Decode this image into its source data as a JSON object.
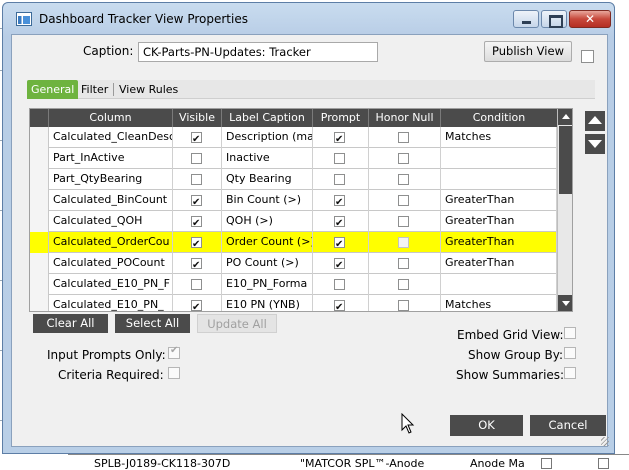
{
  "window": {
    "title": "Dashboard Tracker View Properties",
    "close_glyph": "✕"
  },
  "caption": {
    "label": "Caption:",
    "value": "CK-Parts-PN-Updates: Tracker"
  },
  "publish_button": "Publish View",
  "tabs": [
    {
      "label": "General",
      "active": true
    },
    {
      "label": "Filter",
      "active": false
    },
    {
      "label": "View Rules",
      "active": false
    }
  ],
  "grid": {
    "columns": [
      "Column",
      "Visible",
      "Label Caption",
      "Prompt",
      "Honor Null",
      "Condition"
    ],
    "rows": [
      {
        "column": "Calculated_CleanDesc",
        "visible": true,
        "label": "Description (mat",
        "prompt": true,
        "honor_null": false,
        "condition": "Matches",
        "highlight": false
      },
      {
        "column": "Part_InActive",
        "visible": false,
        "label": "Inactive",
        "prompt": false,
        "honor_null": false,
        "condition": "",
        "highlight": false
      },
      {
        "column": "Part_QtyBearing",
        "visible": false,
        "label": "Qty Bearing",
        "prompt": false,
        "honor_null": false,
        "condition": "",
        "highlight": false
      },
      {
        "column": "Calculated_BinCount",
        "visible": true,
        "label": "Bin Count (>)",
        "prompt": true,
        "honor_null": false,
        "condition": "GreaterThan",
        "highlight": false
      },
      {
        "column": "Calculated_QOH",
        "visible": true,
        "label": "QOH (>)",
        "prompt": true,
        "honor_null": false,
        "condition": "GreaterThan",
        "highlight": false
      },
      {
        "column": "Calculated_OrderCou",
        "visible": true,
        "label": "Order Count (>)",
        "prompt": true,
        "honor_null": false,
        "condition": "GreaterThan",
        "highlight": true
      },
      {
        "column": "Calculated_POCount",
        "visible": true,
        "label": "PO Count (>)",
        "prompt": true,
        "honor_null": false,
        "condition": "GreaterThan",
        "highlight": false
      },
      {
        "column": "Calculated_E10_PN_F",
        "visible": false,
        "label": "E10_PN_Forma",
        "prompt": false,
        "honor_null": false,
        "condition": "",
        "highlight": false
      },
      {
        "column": "Calculated_E10_PN_",
        "visible": true,
        "label": "E10 PN (YNB)",
        "prompt": true,
        "honor_null": false,
        "condition": "Matches",
        "highlight": false
      }
    ]
  },
  "grid_buttons": {
    "clear_all": "Clear All",
    "select_all": "Select All",
    "update_all": "Update All"
  },
  "options": {
    "input_prompts_only": {
      "label": "Input Prompts Only:",
      "checked": true
    },
    "criteria_required": {
      "label": "Criteria Required:",
      "checked": false
    },
    "embed_grid_view": {
      "label": "Embed Grid View:",
      "checked": false
    },
    "show_group_by": {
      "label": "Show Group By:",
      "checked": false
    },
    "show_summaries": {
      "label": "Show Summaries:",
      "checked": false
    }
  },
  "footer": {
    "ok": "OK",
    "cancel": "Cancel"
  },
  "background_row": {
    "part": "SPLB-J0189-CK118-307D",
    "description": "\"MATCOR  SPL™-Anode",
    "short": "Anode Ma"
  },
  "colors": {
    "highlight": "#ffff00",
    "active_tab": "#6eb33f",
    "header_bg": "#4b4b4b"
  }
}
